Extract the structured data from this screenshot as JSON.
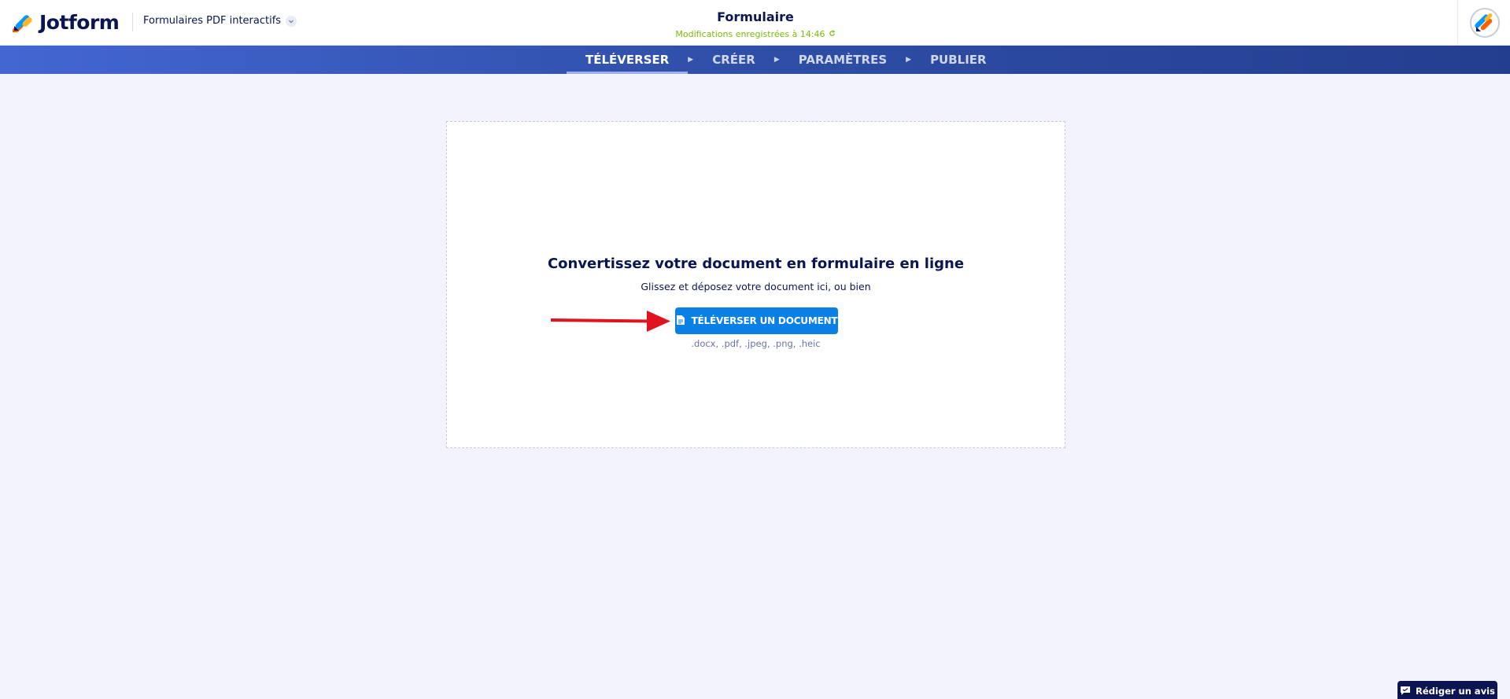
{
  "header": {
    "brand": "Jotform",
    "product_switch": "Formulaires PDF interactifs",
    "form_title": "Formulaire",
    "save_status": "Modifications enregistrées à 14:46"
  },
  "wizard": {
    "steps": [
      {
        "label": "TÉLÉVERSER",
        "active": true
      },
      {
        "label": "CRÉER",
        "active": false
      },
      {
        "label": "PARAMÈTRES",
        "active": false
      },
      {
        "label": "PUBLIER",
        "active": false
      }
    ]
  },
  "upload": {
    "title": "Convertissez votre document en formulaire en ligne",
    "subtitle": "Glissez et déposez votre document ici, ou bien",
    "button_label": "TÉLÉVERSER UN DOCUMENT",
    "formats": ".docx, .pdf, .jpeg, .png, .heic"
  },
  "feedback": {
    "label": "Rédiger un avis"
  },
  "colors": {
    "accent": "#0a80e6",
    "nav_start": "#4466d2",
    "nav_end": "#243e8f",
    "status_green": "#78bb07",
    "arrow_red": "#e0141e"
  }
}
